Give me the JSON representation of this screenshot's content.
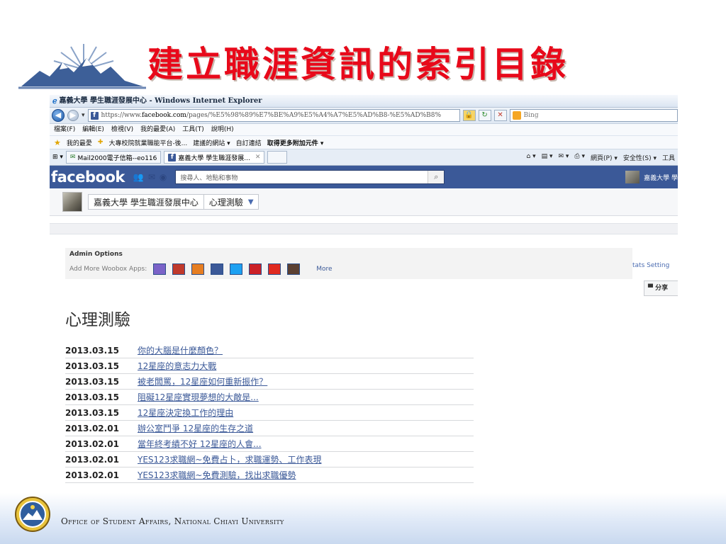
{
  "slide": {
    "title": "建立職涯資訊的索引目錄",
    "footer": "Office of Student Affairs, National Chiayi University"
  },
  "browser": {
    "window_title": "嘉義大學 學生職涯發展中心 - Windows Internet Explorer",
    "url_prefix": "https://www.",
    "url_domain": "facebook.com",
    "url_rest": "/pages/%E5%98%89%E7%BE%A9%E5%A4%A7%E5%AD%B8-%E5%AD%B8%",
    "search_engine": "Bing",
    "menu": [
      "檔案(F)",
      "編輯(E)",
      "檢視(V)",
      "我的最愛(A)",
      "工具(T)",
      "說明(H)"
    ],
    "favorites_bar": {
      "label": "我的最愛",
      "links": [
        "大專校院就業職能平台-後...",
        "建議的網站 ▾",
        "自訂連結",
        "取得更多附加元件 ▾"
      ]
    },
    "tabs": [
      "Mail2000電子信箱--eo116",
      "嘉義大學 學生職涯發展..."
    ],
    "command_bar": [
      "網頁(P) ▾",
      "安全性(S) ▾",
      "工具"
    ]
  },
  "facebook": {
    "logo": "facebook",
    "search_placeholder": "搜尋人、地點和事物",
    "user_name": "嘉義大學 學",
    "breadcrumb_page": "嘉義大學 學生職涯發展中心",
    "breadcrumb_app": "心理測驗",
    "admin": {
      "heading": "Admin Options",
      "add_apps_label": "Add More Woobox Apps:",
      "more": "More"
    },
    "right_links": "tats  Setting",
    "share_label": "分享",
    "page_heading": "心理測驗",
    "posts": [
      {
        "date": "2013.03.15",
        "title": "你的大腦是什麼顏色？"
      },
      {
        "date": "2013.03.15",
        "title": "12星座的意志力大戰"
      },
      {
        "date": "2013.03.15",
        "title": "被老闆罵，12星座如何重新振作？"
      },
      {
        "date": "2013.03.15",
        "title": "阻礙12星座實現夢想的大敵是..."
      },
      {
        "date": "2013.03.15",
        "title": "12星座決定換工作的理由"
      },
      {
        "date": "2013.02.01",
        "title": "辦公室鬥爭 12星座的生存之道"
      },
      {
        "date": "2013.02.01",
        "title": "當年終考績不好 12星座的人會..."
      },
      {
        "date": "2013.02.01",
        "title": "YES123求職網~免費占卜，求職運勢、工作表現"
      },
      {
        "date": "2013.02.01",
        "title": "YES123求職網~免費測驗，找出求職優勢"
      }
    ],
    "app_colors": [
      "#7b63c8",
      "#c0392b",
      "#e67e22",
      "#3b5998",
      "#1da1f2",
      "#cb2027",
      "#e02a20",
      "#5b4032"
    ]
  }
}
